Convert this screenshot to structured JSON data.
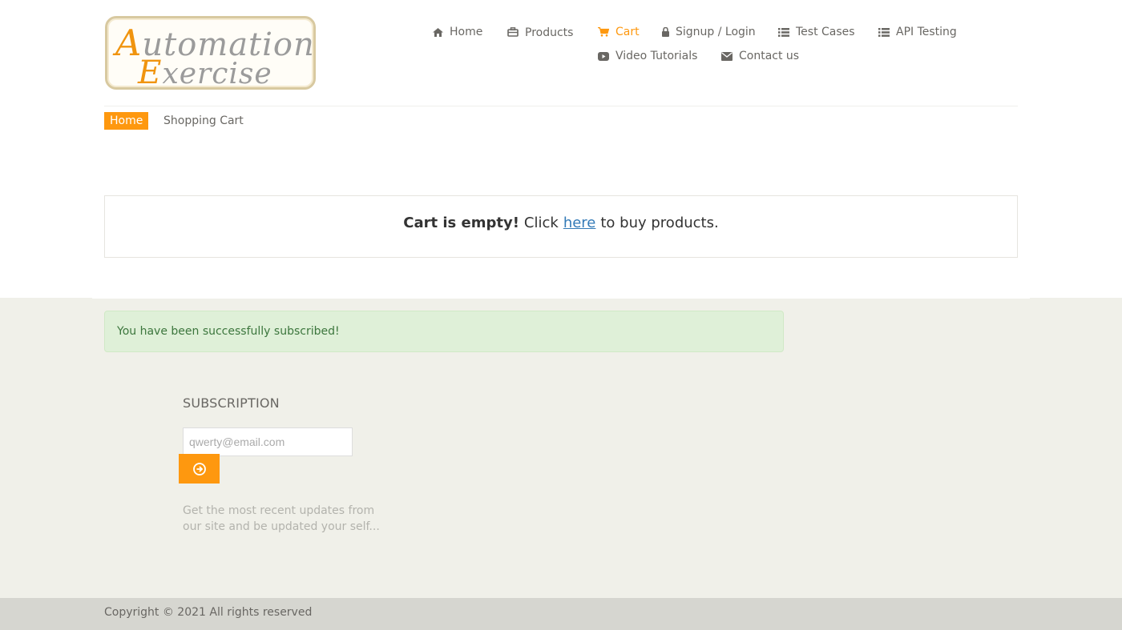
{
  "logo": {
    "line1": "utomation",
    "line1_cap": "A",
    "line2": "xercise",
    "line2_cap": "E",
    "alt": "Automation Exercise"
  },
  "nav": {
    "home": "Home",
    "products": "Products",
    "cart": "Cart",
    "signup": "Signup / Login",
    "test_cases": "Test Cases",
    "api_testing": "API Testing",
    "video_tutorials": "Video Tutorials",
    "contact": "Contact us",
    "active_item": "Cart"
  },
  "breadcrumb": {
    "home": "Home",
    "current": "Shopping Cart"
  },
  "cart": {
    "empty_bold": "Cart is empty!",
    "click": "Click",
    "link": "here",
    "suffix": "to buy products."
  },
  "alert": {
    "message": "You have been successfully subscribed!"
  },
  "subscription": {
    "title": "SUBSCRIPTION",
    "input_value": "qwerty@email.com",
    "description": "Get the most recent updates from our site and be updated your self..."
  },
  "footer": {
    "copyright": "Copyright © 2021 All rights reserved"
  },
  "colors": {
    "accent": "#fe980f",
    "link": "#337ab7",
    "alert_bg": "#dff0d8",
    "alert_text": "#3c763d"
  }
}
